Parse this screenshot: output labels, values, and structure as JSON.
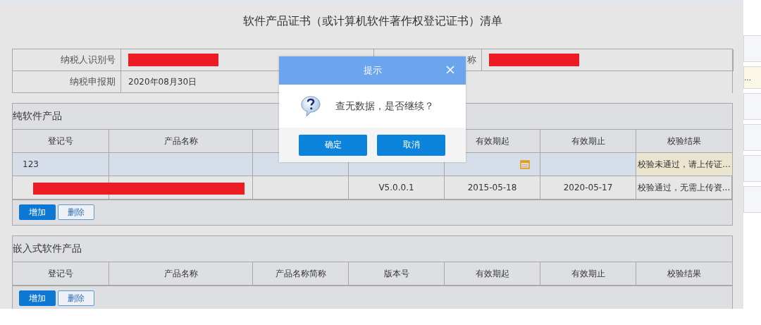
{
  "page_title": "软件产品证书（或计算机软件著作权登记证书）清单",
  "taxpayer_info": [
    {
      "label": "纳税人识别号",
      "redacted": true
    },
    {
      "label": "称",
      "redacted": true
    },
    {
      "label": "纳税申报期",
      "value": "2020年08月30日"
    }
  ],
  "sections": [
    {
      "title": "纯软件产品",
      "columns": [
        {
          "label": "登记号"
        },
        {
          "label": "产品名称"
        },
        {},
        {},
        {
          "label": "有效期起"
        },
        {
          "label": "有效期止"
        },
        {
          "label": "校验结果"
        }
      ],
      "rows": [
        {
          "selected": true,
          "cells": [
            {
              "text": "123"
            },
            {},
            {},
            {},
            {
              "calendar": true
            },
            {},
            {
              "text": "校验未通过，请上传证...",
              "highlighted": true
            }
          ]
        },
        {
          "selected": false,
          "redacted": true,
          "cells": [
            {},
            {},
            {},
            {
              "text": "V5.0.0.1"
            },
            {
              "text": "2015-05-18"
            },
            {
              "text": "2020-05-17"
            },
            {
              "text": "校验通过，无需上传资...",
              "highlighted": false
            }
          ]
        }
      ],
      "buttons": [
        {
          "label": "增加",
          "primary": true
        },
        {
          "label": "删除",
          "primary": false
        }
      ]
    },
    {
      "title": "嵌入式软件产品",
      "columns": [
        {
          "label": "登记号"
        },
        {
          "label": "产品名称"
        },
        {
          "label": "产品名称简称"
        },
        {
          "label": "版本号"
        },
        {
          "label": "有效期起"
        },
        {
          "label": "有效期止"
        },
        {
          "label": "校验结果"
        }
      ],
      "buttons": [
        {
          "label": "增加",
          "primary": true
        },
        {
          "label": "删除",
          "primary": false
        }
      ]
    }
  ],
  "side_panel": {
    "note": "…"
  },
  "dialog": {
    "title": "提示",
    "message": "查无数据，是否继续？",
    "buttons": [
      {
        "label": "确定"
      },
      {
        "label": "取消"
      }
    ]
  }
}
